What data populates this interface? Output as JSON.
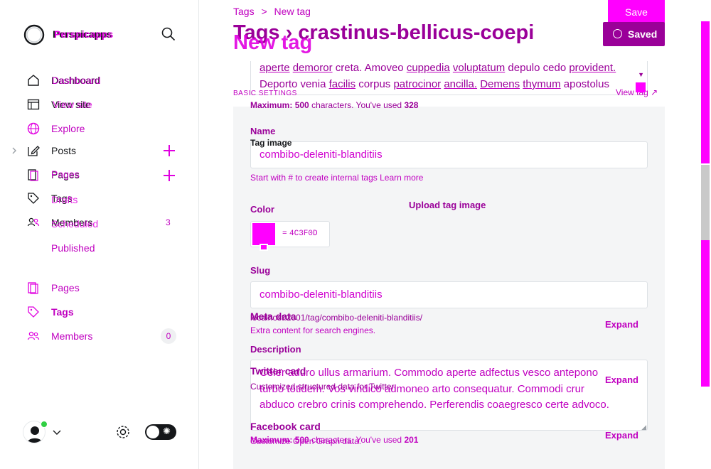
{
  "brand": {
    "name": "Perspicapps",
    "overlay_name": "Perspicapps"
  },
  "sidebar": {
    "items": [
      {
        "key": "dashboard",
        "label": "Dashboard",
        "overlay": "Dashboard"
      },
      {
        "key": "view_site",
        "label": "View site",
        "overlay": "View site"
      },
      {
        "key": "explore",
        "label": "Explore"
      },
      {
        "key": "posts",
        "label": "Posts"
      },
      {
        "key": "pages",
        "label": "Pages",
        "overlay": "Pages"
      },
      {
        "key": "tags",
        "label": "Tags",
        "overlay": "Drafts"
      },
      {
        "key": "members",
        "label": "Members",
        "overlay": "Scheduled",
        "count": "3"
      }
    ],
    "published": "Published",
    "secondary": [
      {
        "key": "pages",
        "label": "Pages"
      },
      {
        "key": "tags",
        "label": "Tags"
      },
      {
        "key": "members",
        "label": "Members",
        "count": "0"
      }
    ]
  },
  "breadcrumb": {
    "parent": "Tags",
    "current": "New tag"
  },
  "page_title": {
    "main": "Tags › crastinus-bellicus-coepi",
    "overlay": "New tag"
  },
  "actions": {
    "save": "Save",
    "saved": "Saved"
  },
  "top_textarea": {
    "line1_parts": [
      "aperte",
      "demoror",
      "creta.",
      "Amoveo",
      "cuppedia",
      "voluptatum",
      "depulo",
      "cedo",
      "provident."
    ],
    "line2_parts": [
      "Deporto",
      "venia",
      "facilis",
      "corpus",
      "patrocinor",
      "ancilla.",
      "Demens",
      "thymum",
      "apostolus"
    ],
    "count_label": "Maximum:",
    "max": "500",
    "used_label": "characters. You've used",
    "used": "328"
  },
  "basic_settings": "BASIC SETTINGS",
  "view_tag": "View tag",
  "name": {
    "label": "Name",
    "value": "combibo-deleniti-blanditiis",
    "help": "Start with # to create internal tags",
    "learn_more": "Learn more"
  },
  "tag_image": {
    "label": "Tag image",
    "upload": "Upload tag image"
  },
  "color": {
    "label": "Color",
    "value": "4C3F0D",
    "prefix": "="
  },
  "slug": {
    "label": "Slug",
    "value": "combibo-deleniti-blanditiis",
    "url": "localhost:2001/tag/combibo-deleniti-blanditiis/"
  },
  "meta": {
    "label": "Meta data",
    "desc": "Extra content for search engines.",
    "expand": "Expand"
  },
  "description": {
    "label": "Description",
    "line1": "Celer aduro ullus armarium. Commodo aperte adfectus vesco antepono",
    "line2": "turbo totidem. Vos vindico admoneo arto consequatur. Commodi crur",
    "line3": "abduco crebro crinis comprehendo. Perferendis coaegresco certe advoco.",
    "count_label": "Maximum:",
    "max": "500",
    "used_label": "characters. You've used",
    "used": "201"
  },
  "twitter": {
    "label": "Twitter card",
    "desc": "Customized structured data for Twitter.",
    "expand": "Expand"
  },
  "facebook": {
    "label": "Facebook card",
    "desc": "Customize Open Graph data.",
    "expand": "Expand"
  },
  "colors": {
    "accent": "#e000e0",
    "accent_dark": "#9a0099",
    "saved_bg": "#9a0099",
    "swatch": "#ff00ff",
    "scrollbar": "#ff00ff"
  }
}
